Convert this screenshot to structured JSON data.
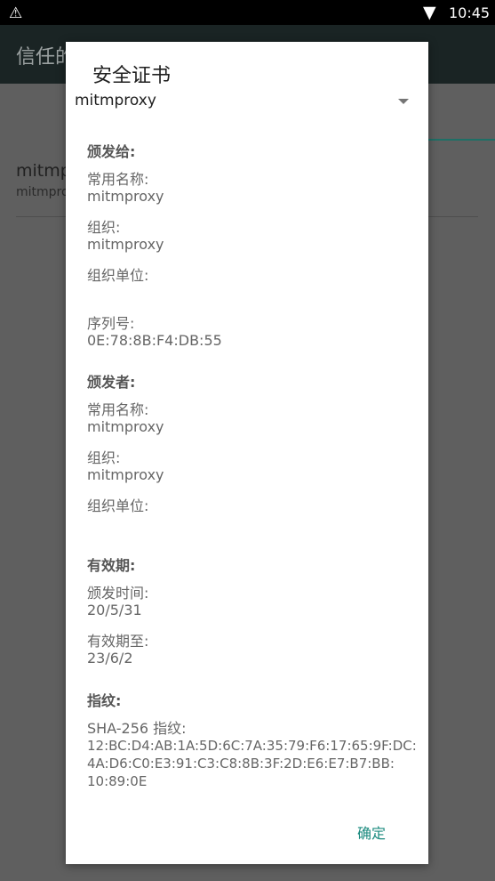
{
  "status_bar": {
    "time": "10:45",
    "icons": [
      "warning-icon",
      "wifi-icon"
    ]
  },
  "background": {
    "app_title": "信任的",
    "list_item_title": "mitmp",
    "list_item_subtitle": "mitmpro"
  },
  "dialog": {
    "title": "安全证书",
    "spinner_value": "mitmproxy",
    "issued_to": {
      "header": "颁发给:",
      "common_name_label": "常用名称:",
      "common_name_value": "mitmproxy",
      "org_label": "组织:",
      "org_value": "mitmproxy",
      "org_unit_label": "组织单位:",
      "org_unit_value": "",
      "serial_label": "序列号:",
      "serial_value": "0E:78:8B:F4:DB:55"
    },
    "issued_by": {
      "header": "颁发者:",
      "common_name_label": "常用名称:",
      "common_name_value": "mitmproxy",
      "org_label": "组织:",
      "org_value": "mitmproxy",
      "org_unit_label": "组织单位:",
      "org_unit_value": ""
    },
    "validity": {
      "header": "有效期:",
      "issued_on_label": "颁发时间:",
      "issued_on_value": "20/5/31",
      "expires_label": "有效期至:",
      "expires_value": "23/6/2"
    },
    "fingerprints": {
      "header": "指纹:",
      "sha256_label": "SHA-256 指纹:",
      "sha256_line1": "12:BC:D4:AB:1A:5D:6C:7A:35:79:F6:17:65:9F:DC:",
      "sha256_line2": "4A:D6:C0:E3:91:C3:C8:8B:3F:2D:E6:E7:B7:BB:",
      "sha256_line3": "10:89:0E"
    },
    "ok_button": "确定"
  },
  "colors": {
    "accent": "#1a8a7e",
    "scrim": "#5e5e5e",
    "appbar": "#1a2424"
  }
}
